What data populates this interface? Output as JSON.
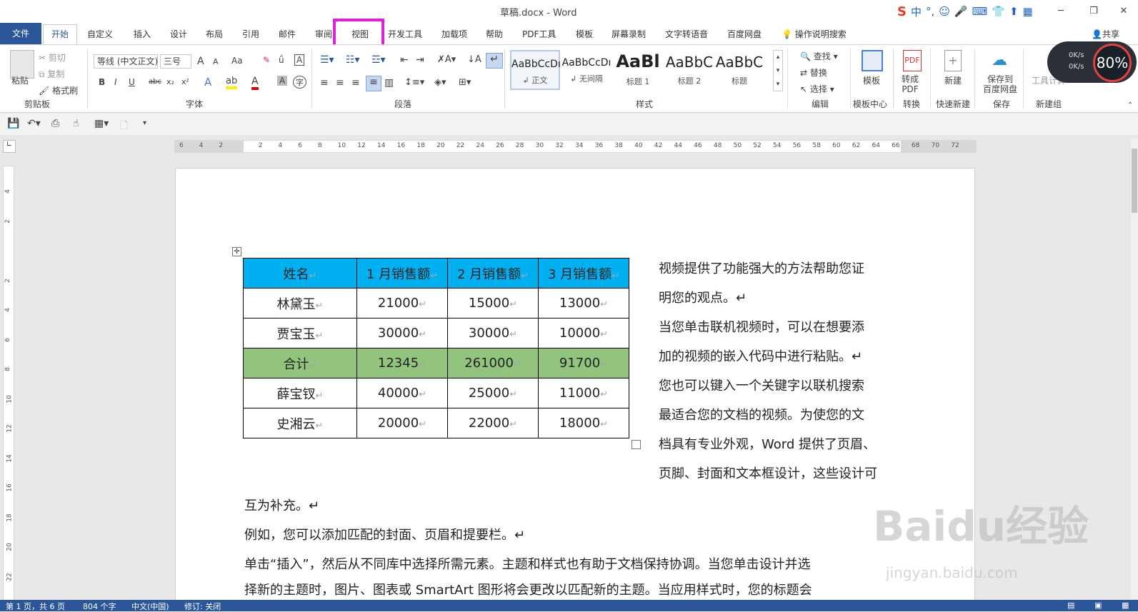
{
  "titlebar": {
    "title": "草稿.docx  -  Word",
    "minimize": "─",
    "restore": "❐",
    "close": "✕"
  },
  "ime": {
    "logo": "S",
    "items": [
      "中",
      "°,",
      "☺",
      "🎤",
      "⌨",
      "👕",
      "⬆",
      "▦"
    ]
  },
  "tabs": [
    "文件",
    "开始",
    "自定义",
    "插入",
    "设计",
    "布局",
    "引用",
    "邮件",
    "审阅",
    "视图",
    "开发工具",
    "加载项",
    "帮助",
    "PDF工具",
    "模板",
    "屏幕录制",
    "文字转语音",
    "百度网盘"
  ],
  "tellme": "操作说明搜索",
  "share": "共享",
  "ribbon": {
    "clipboard": {
      "paste": "粘贴",
      "cut": "剪切",
      "copy": "复制",
      "painter": "格式刷",
      "label": "剪贴板"
    },
    "font": {
      "name": "等线 (中文正文)",
      "size": "三号",
      "label": "字体",
      "grow": "A",
      "shrink": "A",
      "case": "Aa",
      "bold": "B",
      "italic": "I",
      "underline": "U",
      "strike": "abc",
      "sub": "x₂",
      "sup": "x²"
    },
    "paragraph": {
      "label": "段落"
    },
    "styles": {
      "label": "样式",
      "items": [
        {
          "preview": "AaBbCcDı",
          "name": "↲ 正文"
        },
        {
          "preview": "AaBbCcDı",
          "name": "↲ 无间隔"
        },
        {
          "preview": "AaBl",
          "name": "标题 1"
        },
        {
          "preview": "AaBbC",
          "name": "标题 2"
        },
        {
          "preview": "AaBbC",
          "name": "标题"
        }
      ]
    },
    "editing": {
      "find": "查找",
      "replace": "替换",
      "select": "选择",
      "label": "编辑"
    },
    "template": {
      "btn": "模板",
      "label": "模板中心"
    },
    "convert": {
      "btn": "转成\nPDF",
      "label": "转换"
    },
    "newquick": {
      "btn": "新建",
      "label": "快速新建"
    },
    "save": {
      "btn": "保存到\n百度网盘",
      "label": "保存"
    },
    "newgroup": {
      "btn": "工具计算",
      "label": "新建组"
    }
  },
  "speed": {
    "up": "0K/s",
    "down": "0K/s",
    "percent": "80%"
  },
  "ruler": {
    "h": [
      "6",
      "4",
      "2",
      "",
      "2",
      "4",
      "6",
      "8",
      "10",
      "12",
      "14",
      "16",
      "18",
      "20",
      "22",
      "24",
      "26",
      "28",
      "30",
      "32",
      "34",
      "36",
      "38",
      "40",
      "42",
      "44",
      "46",
      "48",
      "50",
      "52",
      "54",
      "56",
      "58",
      "60",
      "62",
      "64",
      "66",
      "68",
      "70",
      "72"
    ],
    "v": [
      "4",
      "2",
      "",
      "2",
      "4",
      "6",
      "8",
      "10",
      "12",
      "14",
      "16",
      "18",
      "20",
      "22"
    ]
  },
  "table": {
    "header": [
      "姓名",
      "1 月销售额",
      "2 月销售额",
      "3 月销售额"
    ],
    "rows": [
      [
        "林黛玉",
        "21000",
        "15000",
        "13000"
      ],
      [
        "贾宝玉",
        "30000",
        "30000",
        "10000"
      ],
      [
        "合计",
        "12345",
        "261000",
        "91700"
      ],
      [
        "薛宝钗",
        "40000",
        "25000",
        "11000"
      ],
      [
        "史湘云",
        "20000",
        "22000",
        "18000"
      ]
    ],
    "colors": {
      "header": "#00b0f0",
      "total": "#92c47d"
    }
  },
  "text": {
    "right": [
      "视频提供了功能强大的方法帮助您证",
      "明您的观点。↵",
      "当您单击联机视频时，可以在想要添",
      "加的视频的嵌入代码中进行粘贴。↵",
      "您也可以键入一个关键字以联机搜索",
      "最适合您的文档的视频。为使您的文",
      "档具有专业外观，Word 提供了页眉、",
      "页脚、封面和文本框设计，这些设计可"
    ],
    "body": [
      "互为补充。↵",
      "例如，您可以添加匹配的封面、页眉和提要栏。↵",
      "单击“插入”，然后从不同库中选择所需元素。主题和样式也有助于文档保持协调。当您单击设计并选",
      "择新的主题时，图片、图表或 SmartArt 图形将会更改以匹配新的主题。当应用样式时，您的标题会"
    ]
  },
  "status": {
    "page": "第 1 页，共 6 页",
    "words": "804 个字",
    "lang": "中文(中国)",
    "track": "修订: 关闭"
  },
  "watermark": {
    "logo": "Baidu经验",
    "url": "jingyan.baidu.com"
  }
}
